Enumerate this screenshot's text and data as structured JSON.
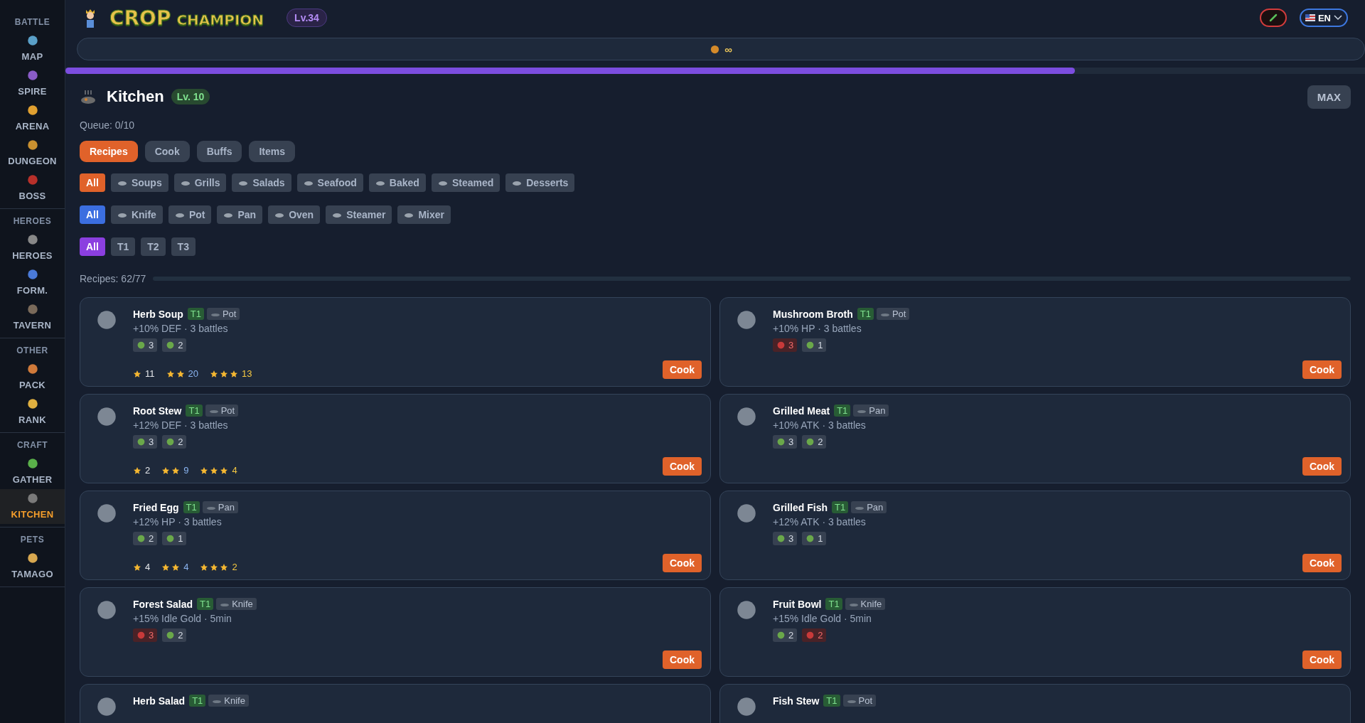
{
  "sidebar": {
    "sections": [
      {
        "title": "BATTLE",
        "items": [
          {
            "label": "MAP",
            "selected": false
          },
          {
            "label": "SPIRE",
            "selected": false
          },
          {
            "label": "ARENA",
            "selected": false
          },
          {
            "label": "DUNGEON",
            "selected": false
          },
          {
            "label": "BOSS",
            "selected": false
          }
        ]
      },
      {
        "title": "HEROES",
        "items": [
          {
            "label": "HEROES",
            "selected": false
          },
          {
            "label": "FORM.",
            "selected": false
          },
          {
            "label": "TAVERN",
            "selected": false
          }
        ]
      },
      {
        "title": "OTHER",
        "items": [
          {
            "label": "PACK",
            "selected": false
          },
          {
            "label": "RANK",
            "selected": false
          }
        ]
      },
      {
        "title": "CRAFT",
        "items": [
          {
            "label": "GATHER",
            "selected": false
          },
          {
            "label": "KITCHEN",
            "selected": true
          }
        ]
      },
      {
        "title": "PETS",
        "items": [
          {
            "label": "TAMAGO",
            "selected": false
          }
        ]
      }
    ]
  },
  "header": {
    "logo_main": "CROP",
    "logo_sub": "CHAMPION",
    "level": "Lv.34",
    "language": "EN",
    "gold": "∞",
    "xp": {
      "level": 0.777
    }
  },
  "kitchen": {
    "title": "Kitchen",
    "level": "Lv. 10",
    "max_button": "MAX",
    "queue": "Queue: 0/10",
    "tabs": [
      {
        "label": "Recipes",
        "selected": true
      },
      {
        "label": "Cook",
        "selected": false
      },
      {
        "label": "Buffs",
        "selected": false
      },
      {
        "label": "Items",
        "selected": false
      }
    ],
    "categories": [
      {
        "label": "All",
        "selected": true
      },
      {
        "label": "Soups",
        "selected": false
      },
      {
        "label": "Grills",
        "selected": false
      },
      {
        "label": "Salads",
        "selected": false
      },
      {
        "label": "Seafood",
        "selected": false
      },
      {
        "label": "Baked",
        "selected": false
      },
      {
        "label": "Steamed",
        "selected": false
      },
      {
        "label": "Desserts",
        "selected": false
      }
    ],
    "tools": [
      {
        "label": "All",
        "selected": true
      },
      {
        "label": "Knife",
        "selected": false
      },
      {
        "label": "Pot",
        "selected": false
      },
      {
        "label": "Pan",
        "selected": false
      },
      {
        "label": "Oven",
        "selected": false
      },
      {
        "label": "Steamer",
        "selected": false
      },
      {
        "label": "Mixer",
        "selected": false
      }
    ],
    "tiers": [
      {
        "label": "All",
        "selected": true
      },
      {
        "label": "T1",
        "selected": false
      },
      {
        "label": "T2",
        "selected": false
      },
      {
        "label": "T3",
        "selected": false
      }
    ],
    "recipes_count": "Recipes: 62/77",
    "recipes": [
      {
        "name": "Herb Soup",
        "tier": "T1",
        "tool": "Pot",
        "effect": "+10% DEF · 3 battles",
        "ingredients": [
          {
            "count": "3",
            "lacking": false
          },
          {
            "count": "2",
            "lacking": false
          }
        ],
        "quality": [
          {
            "kind": "single",
            "count": "11"
          },
          {
            "kind": "double",
            "count": "20"
          },
          {
            "kind": "triple",
            "count": "13"
          }
        ],
        "button": "Cook"
      },
      {
        "name": "Mushroom Broth",
        "tier": "T1",
        "tool": "Pot",
        "effect": "+10% HP · 3 battles",
        "ingredients": [
          {
            "count": "3",
            "lacking": true
          },
          {
            "count": "1",
            "lacking": false
          }
        ],
        "button": "Cook"
      },
      {
        "name": "Root Stew",
        "tier": "T1",
        "tool": "Pot",
        "effect": "+12% DEF · 3 battles",
        "ingredients": [
          {
            "count": "3",
            "lacking": false
          },
          {
            "count": "2",
            "lacking": false
          }
        ],
        "quality": [
          {
            "kind": "single",
            "count": "2"
          },
          {
            "kind": "double",
            "count": "9"
          },
          {
            "kind": "triple",
            "count": "4"
          }
        ],
        "button": "Cook"
      },
      {
        "name": "Grilled Meat",
        "tier": "T1",
        "tool": "Pan",
        "effect": "+10% ATK · 3 battles",
        "ingredients": [
          {
            "count": "3",
            "lacking": false
          },
          {
            "count": "2",
            "lacking": false
          }
        ],
        "button": "Cook"
      },
      {
        "name": "Fried Egg",
        "tier": "T1",
        "tool": "Pan",
        "effect": "+12% HP · 3 battles",
        "ingredients": [
          {
            "count": "2",
            "lacking": false
          },
          {
            "count": "1",
            "lacking": false
          }
        ],
        "quality": [
          {
            "kind": "single",
            "count": "4"
          },
          {
            "kind": "double",
            "count": "4"
          },
          {
            "kind": "triple",
            "count": "2"
          }
        ],
        "button": "Cook"
      },
      {
        "name": "Grilled Fish",
        "tier": "T1",
        "tool": "Pan",
        "effect": "+12% ATK · 3 battles",
        "ingredients": [
          {
            "count": "3",
            "lacking": false
          },
          {
            "count": "1",
            "lacking": false
          }
        ],
        "button": "Cook"
      },
      {
        "name": "Forest Salad",
        "tier": "T1",
        "tool": "Knife",
        "effect": "+15% Idle Gold · 5min",
        "ingredients": [
          {
            "count": "3",
            "lacking": true
          },
          {
            "count": "2",
            "lacking": false
          }
        ],
        "button": "Cook"
      },
      {
        "name": "Fruit Bowl",
        "tier": "T1",
        "tool": "Knife",
        "effect": "+15% Idle Gold · 5min",
        "ingredients": [
          {
            "count": "2",
            "lacking": false
          },
          {
            "count": "2",
            "lacking": true
          }
        ],
        "button": "Cook"
      },
      {
        "name": "Herb Salad",
        "tier": "T1",
        "tool": "Knife"
      },
      {
        "name": "Fish Stew",
        "tier": "T1",
        "tool": "Pot"
      }
    ]
  }
}
